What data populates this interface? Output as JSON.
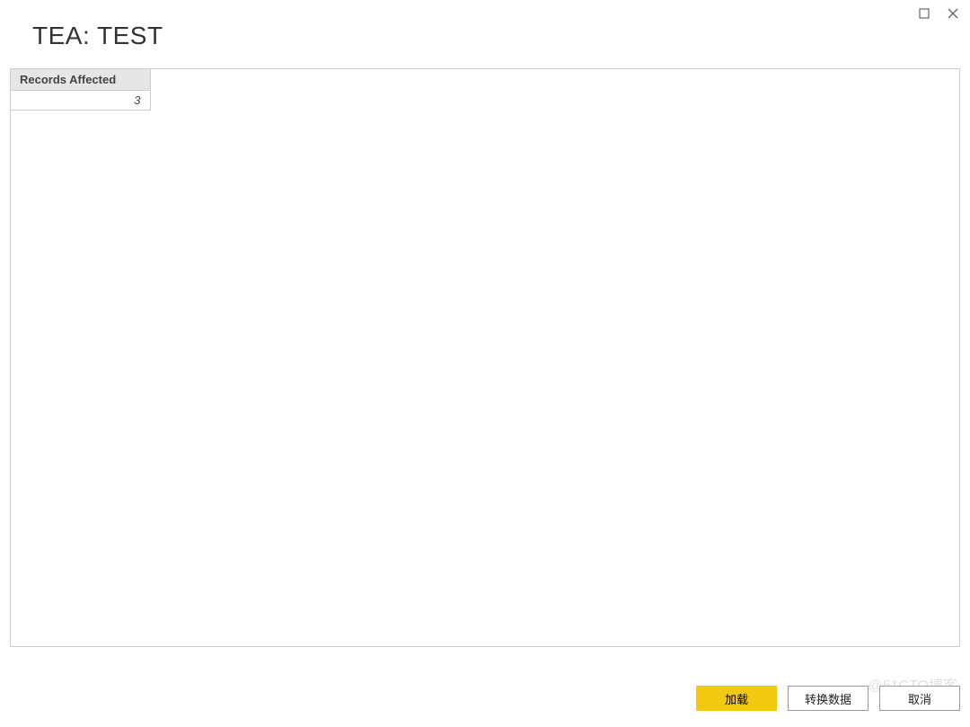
{
  "window": {
    "title": "TEA: TEST"
  },
  "table": {
    "header": "Records Affected",
    "value": "3"
  },
  "buttons": {
    "load": "加载",
    "transform": "转换数据",
    "cancel": "取消"
  },
  "watermark": "@51CTO博客"
}
